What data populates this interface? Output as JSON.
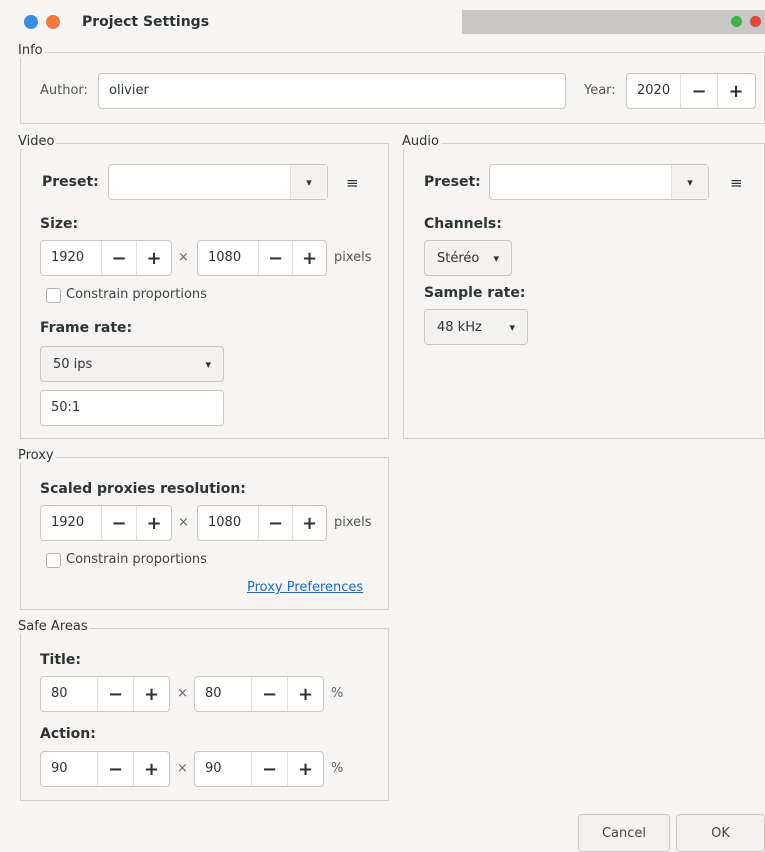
{
  "window": {
    "title": "Project Settings"
  },
  "info": {
    "legend": "Info",
    "author_label": "Author:",
    "author_value": "olivier",
    "year_label": "Year:",
    "year_value": "2020"
  },
  "video": {
    "legend": "Video",
    "preset_label": "Preset:",
    "preset_value": "",
    "size_label": "Size:",
    "width": "1920",
    "height": "1080",
    "times": "×",
    "unit": "pixels",
    "constrain_label": "Constrain proportions",
    "framerate_label": "Frame rate:",
    "framerate_value": "50 ips",
    "framerate_entry": "50:1"
  },
  "audio": {
    "legend": "Audio",
    "preset_label": "Preset:",
    "preset_value": "",
    "channels_label": "Channels:",
    "channels_value": "Stéréo",
    "samplerate_label": "Sample rate:",
    "samplerate_value": "48 kHz"
  },
  "proxy": {
    "legend": "Proxy",
    "scaled_label": "Scaled proxies resolution:",
    "width": "1920",
    "height": "1080",
    "times": "×",
    "unit": "pixels",
    "constrain_label": "Constrain proportions",
    "preferences_link": "Proxy Preferences"
  },
  "safe_areas": {
    "legend": "Safe Areas",
    "title_label": "Title:",
    "title_w": "80",
    "title_h": "80",
    "action_label": "Action:",
    "action_w": "90",
    "action_h": "90",
    "times": "×",
    "unit": "%"
  },
  "spin": {
    "minus": "−",
    "plus": "+"
  },
  "icons": {
    "menu": "≡",
    "dropdown": "▾"
  },
  "buttons": {
    "cancel": "Cancel",
    "ok": "OK"
  }
}
